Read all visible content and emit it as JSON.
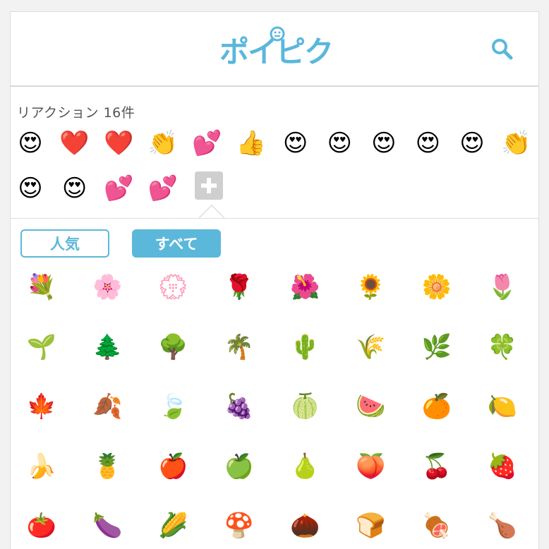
{
  "app": {
    "logo_text": "ポイピク"
  },
  "icons": {
    "search": "search-icon",
    "add_reaction": "plus-icon"
  },
  "reactions": {
    "title": "リアクション 16件",
    "items": [
      "😍",
      "❤️",
      "❤️",
      "👏",
      "💕",
      "👍",
      "😍",
      "😍",
      "😍",
      "😍",
      "😍",
      "👏",
      "😍",
      "😍",
      "💕",
      "💕"
    ]
  },
  "tabs": [
    {
      "label": "人気",
      "selected": false
    },
    {
      "label": "すべて",
      "selected": true
    }
  ],
  "emoji_grid": [
    "💐",
    "🌸",
    "💮",
    "🌹",
    "🌺",
    "🌻",
    "🌼",
    "🌷",
    "🌱",
    "🌲",
    "🌳",
    "🌴",
    "🌵",
    "🌾",
    "🌿",
    "🍀",
    "🍁",
    "🍂",
    "🍃",
    "🍇",
    "🍈",
    "🍉",
    "🍊",
    "🍋",
    "🍌",
    "🍍",
    "🍎",
    "🍏",
    "🍐",
    "🍑",
    "🍒",
    "🍓",
    "🍅",
    "🍆",
    "🌽",
    "🍄",
    "🌰",
    "🍞",
    "🍖",
    "🍗"
  ],
  "colors": {
    "accent": "#5cb8da",
    "background": "#ffffff",
    "divider": "#dcdcdc"
  }
}
